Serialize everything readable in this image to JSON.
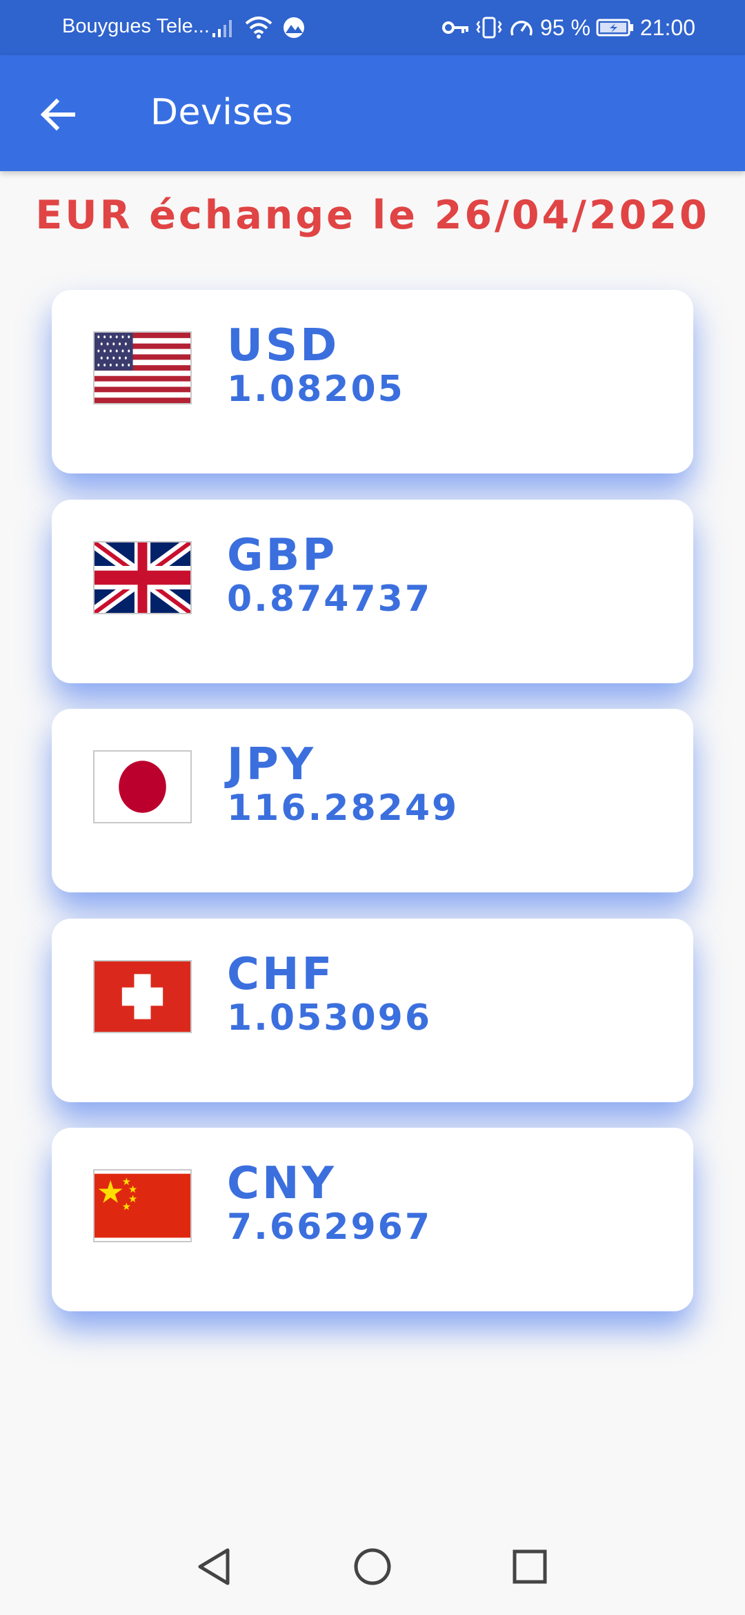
{
  "status_bar": {
    "carrier": "Bouygues Tele...",
    "battery": "95 %",
    "time": "21:00"
  },
  "app_bar": {
    "title": "Devises",
    "back_icon": "arrow-back-icon"
  },
  "heading": "EUR échange le 26/04/2020",
  "currencies": [
    {
      "code": "USD",
      "value": "1.08205",
      "flag": "us-flag-icon"
    },
    {
      "code": "GBP",
      "value": "0.874737",
      "flag": "uk-flag-icon"
    },
    {
      "code": "JPY",
      "value": "116.28249",
      "flag": "japan-flag-icon"
    },
    {
      "code": "CHF",
      "value": "1.053096",
      "flag": "switzerland-flag-icon"
    },
    {
      "code": "CNY",
      "value": "7.662967",
      "flag": "china-flag-icon"
    }
  ],
  "nav_bar": {
    "back_icon": "triangle-back-icon",
    "home_icon": "circle-home-icon",
    "recents_icon": "square-recents-icon"
  },
  "colors": {
    "primary": "#376fe3",
    "status_bar": "#2f63cd",
    "heading": "#e04444",
    "card_text": "#3b6fde"
  }
}
